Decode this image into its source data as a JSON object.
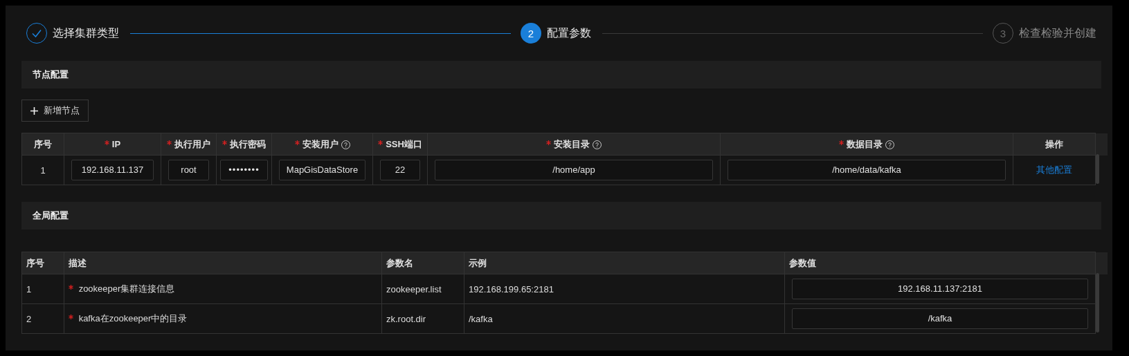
{
  "steps": [
    {
      "label": "选择集群类型",
      "finished": true,
      "current": false
    },
    {
      "number": "2",
      "label": "配置参数",
      "finished": false,
      "current": true
    },
    {
      "number": "3",
      "label": "检查检验并创建",
      "finished": false,
      "current": false
    }
  ],
  "node_section": {
    "title": "节点配置",
    "add_button": "新增节点",
    "table": {
      "columns": [
        {
          "label": "序号",
          "required": false,
          "help": false
        },
        {
          "label": "IP",
          "required": true,
          "help": false
        },
        {
          "label": "执行用户",
          "required": true,
          "help": false
        },
        {
          "label": "执行密码",
          "required": true,
          "help": false
        },
        {
          "label": "安装用户",
          "required": true,
          "help": true
        },
        {
          "label": "SSH端口",
          "required": true,
          "help": false
        },
        {
          "label": "安装目录",
          "required": true,
          "help": true
        },
        {
          "label": "数据目录",
          "required": true,
          "help": true
        },
        {
          "label": "操作",
          "required": false,
          "help": false
        }
      ],
      "rows": [
        [
          {
            "kind": "text",
            "text": "1"
          },
          {
            "kind": "input",
            "text": "192.168.11.137"
          },
          {
            "kind": "input",
            "text": "root"
          },
          {
            "kind": "password",
            "text": "••••••••"
          },
          {
            "kind": "input",
            "text": "MapGisDataStore"
          },
          {
            "kind": "input",
            "text": "22"
          },
          {
            "kind": "input",
            "text": "/home/app"
          },
          {
            "kind": "input",
            "text": "/home/data/kafka"
          },
          {
            "kind": "link",
            "text": "其他配置"
          }
        ]
      ]
    }
  },
  "global_section": {
    "title": "全局配置",
    "table": {
      "columns": [
        {
          "label": "序号"
        },
        {
          "label": "描述"
        },
        {
          "label": "参数名"
        },
        {
          "label": "示例"
        },
        {
          "label": "参数值"
        }
      ],
      "rows": [
        [
          {
            "kind": "text",
            "text": "1"
          },
          {
            "kind": "text",
            "required": true,
            "text": "zookeeper集群连接信息"
          },
          {
            "kind": "text",
            "text": "zookeeper.list"
          },
          {
            "kind": "text",
            "text": "192.168.199.65:2181"
          },
          {
            "kind": "input",
            "text": "192.168.11.137:2181"
          }
        ],
        [
          {
            "kind": "text",
            "text": "2"
          },
          {
            "kind": "text",
            "required": true,
            "text": "kafka在zookeeper中的目录"
          },
          {
            "kind": "text",
            "text": "zk.root.dir"
          },
          {
            "kind": "text",
            "text": "/kafka"
          },
          {
            "kind": "input",
            "text": "/kafka"
          }
        ]
      ]
    }
  }
}
